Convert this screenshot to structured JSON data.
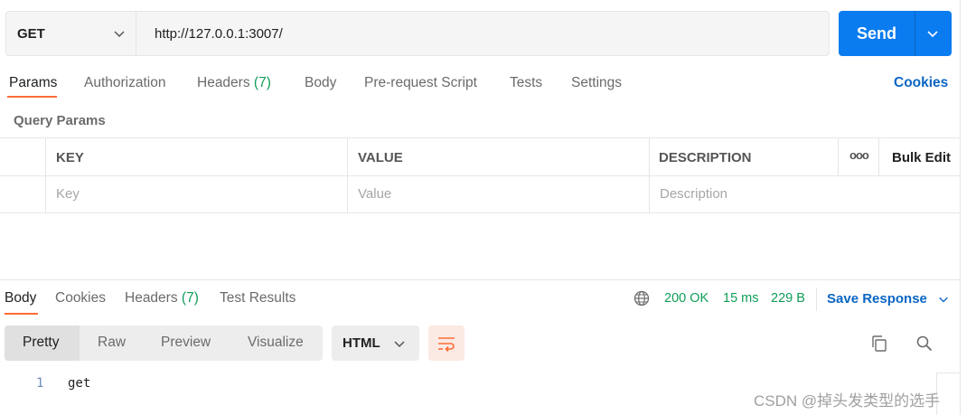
{
  "request": {
    "method": "GET",
    "url": "http://127.0.0.1:3007/",
    "send_label": "Send"
  },
  "request_tabs": [
    {
      "label": "Params",
      "count": ""
    },
    {
      "label": "Authorization",
      "count": ""
    },
    {
      "label": "Headers",
      "count": "(7)"
    },
    {
      "label": "Body",
      "count": ""
    },
    {
      "label": "Pre-request Script",
      "count": ""
    },
    {
      "label": "Tests",
      "count": ""
    },
    {
      "label": "Settings",
      "count": ""
    }
  ],
  "cookies_link": "Cookies",
  "query_params": {
    "title": "Query Params",
    "columns": [
      "KEY",
      "VALUE",
      "DESCRIPTION"
    ],
    "more_label": "ooo",
    "bulk_edit_label": "Bulk Edit",
    "placeholders": {
      "key": "Key",
      "value": "Value",
      "description": "Description"
    }
  },
  "response": {
    "tabs": [
      {
        "label": "Body",
        "count": ""
      },
      {
        "label": "Cookies",
        "count": ""
      },
      {
        "label": "Headers",
        "count": "(7)"
      },
      {
        "label": "Test Results",
        "count": ""
      }
    ],
    "status": "200 OK",
    "time": "15 ms",
    "size": "229 B",
    "save_label": "Save Response",
    "view_modes": [
      "Pretty",
      "Raw",
      "Preview",
      "Visualize"
    ],
    "format": "HTML",
    "body_lines": [
      {
        "no": "1",
        "text": "get"
      }
    ]
  },
  "watermark": "CSDN @掉头发类型的选手",
  "colors": {
    "accent_orange": "#ff6c37",
    "send_blue": "#0a7cf0",
    "link_blue": "#0b66c3",
    "status_green": "#0f9d58"
  },
  "icons": [
    "chevron-down-icon",
    "globe-icon",
    "wrap-lines-icon",
    "copy-icon",
    "search-icon"
  ]
}
